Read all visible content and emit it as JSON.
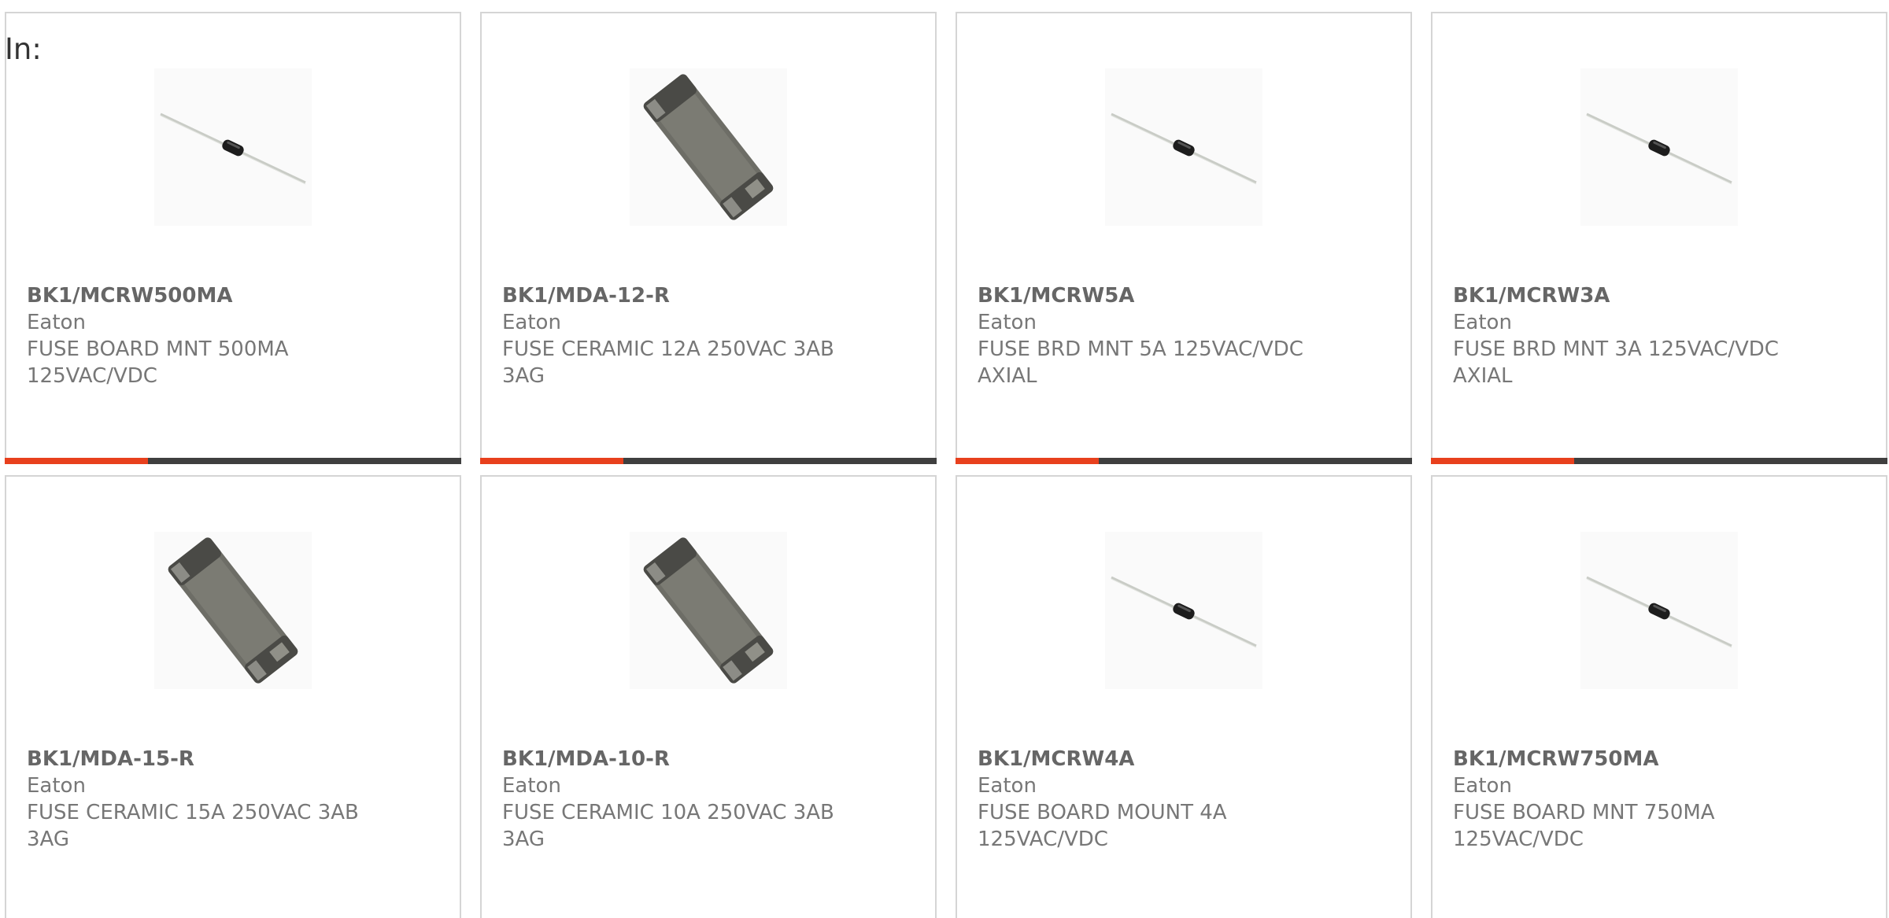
{
  "filter_label": "In:",
  "colors": {
    "accent": "#e8401d",
    "bar": "#3f3f3f",
    "border": "#d5d5d5"
  },
  "products": [
    {
      "part": "BK1/MCRW500MA",
      "maker": "Eaton",
      "desc": "FUSE BOARD MNT 500MA 125VAC/VDC",
      "image": "axial-fuse-icon"
    },
    {
      "part": "BK1/MDA-12-R",
      "maker": "Eaton",
      "desc": "FUSE CERAMIC 12A 250VAC 3AB 3AG",
      "image": "cartridge-fuse-icon"
    },
    {
      "part": "BK1/MCRW5A",
      "maker": "Eaton",
      "desc": "FUSE BRD MNT 5A 125VAC/VDC AXIAL",
      "image": "axial-fuse-icon"
    },
    {
      "part": "BK1/MCRW3A",
      "maker": "Eaton",
      "desc": "FUSE BRD MNT 3A 125VAC/VDC AXIAL",
      "image": "axial-fuse-icon"
    },
    {
      "part": "BK1/MDA-15-R",
      "maker": "Eaton",
      "desc": "FUSE CERAMIC 15A 250VAC 3AB 3AG",
      "image": "cartridge-fuse-icon"
    },
    {
      "part": "BK1/MDA-10-R",
      "maker": "Eaton",
      "desc": "FUSE CERAMIC 10A 250VAC 3AB 3AG",
      "image": "cartridge-fuse-icon"
    },
    {
      "part": "BK1/MCRW4A",
      "maker": "Eaton",
      "desc": "FUSE BOARD MOUNT 4A 125VAC/VDC",
      "image": "axial-fuse-icon"
    },
    {
      "part": "BK1/MCRW750MA",
      "maker": "Eaton",
      "desc": "FUSE BOARD MNT 750MA 125VAC/VDC",
      "image": "axial-fuse-icon"
    }
  ]
}
